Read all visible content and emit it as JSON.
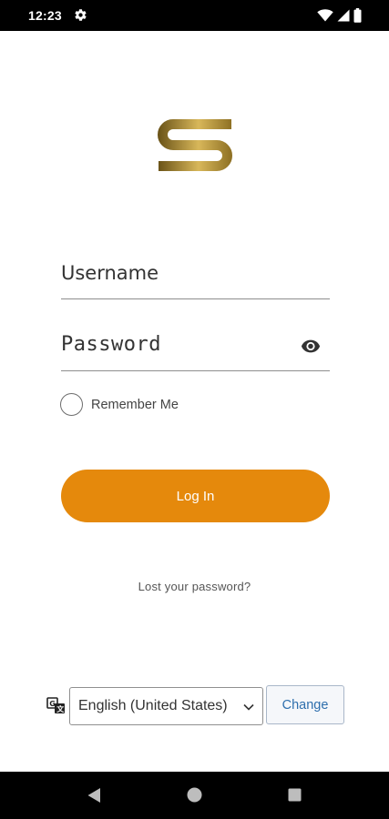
{
  "status_bar": {
    "time": "12:23",
    "icons": [
      "gear-icon",
      "wifi-icon",
      "signal-icon",
      "battery-icon"
    ]
  },
  "logo": {
    "icon": "s-logo",
    "colors": [
      "#6b5418",
      "#d8b75a",
      "#8f7124"
    ]
  },
  "login_form": {
    "username_placeholder": "Username",
    "password_placeholder": "Password",
    "password_toggle_icon": "eye-icon",
    "remember_label": "Remember Me",
    "remember_checked": false,
    "login_label": "Log In",
    "login_color": "#e5890c"
  },
  "lost_password": {
    "label": "Lost your password?"
  },
  "language": {
    "icon": "translate-icon",
    "selected": "English (United States)",
    "change_label": "Change",
    "change_color": "#2e6fad"
  },
  "nav_bar": {
    "icons": [
      "back-icon",
      "home-icon",
      "recents-icon"
    ]
  }
}
